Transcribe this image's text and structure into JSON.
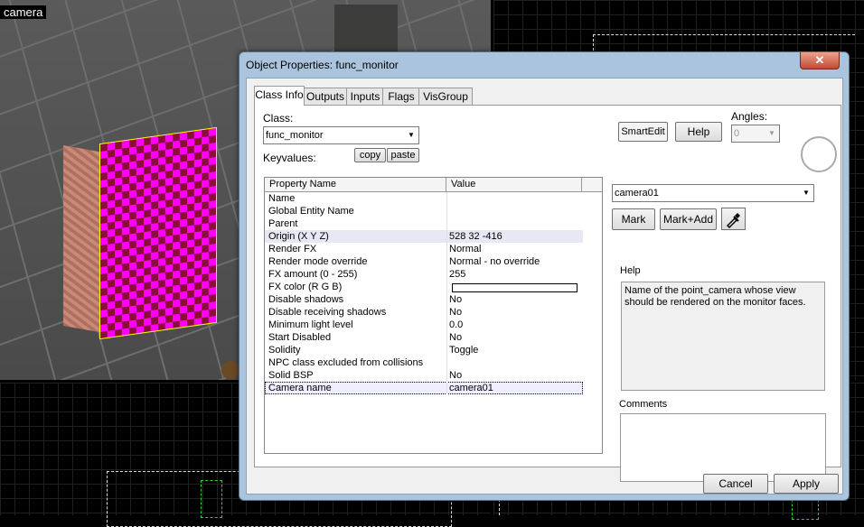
{
  "viewport": {
    "label": "camera"
  },
  "dialog": {
    "title": "Object Properties: func_monitor",
    "close_glyph": "✕",
    "tabs": [
      "Class Info",
      "Outputs",
      "Inputs",
      "Flags",
      "VisGroup"
    ],
    "class_label": "Class:",
    "class_value": "func_monitor",
    "keyvalues_label": "Keyvalues:",
    "copy_label": "copy",
    "paste_label": "paste",
    "smartedit_label": "SmartEdit",
    "help_label": "Help",
    "angles_label": "Angles:",
    "angles_value": "0",
    "columns": [
      "Property Name",
      "Value"
    ],
    "rows": [
      {
        "name": "Name",
        "value": ""
      },
      {
        "name": "Global Entity Name",
        "value": ""
      },
      {
        "name": "Parent",
        "value": ""
      },
      {
        "name": "Origin (X Y Z)",
        "value": "528 32 -416"
      },
      {
        "name": "Render FX",
        "value": "Normal"
      },
      {
        "name": "Render mode override",
        "value": "Normal - no override"
      },
      {
        "name": "FX amount (0 - 255)",
        "value": "255"
      },
      {
        "name": "FX color (R G B)",
        "value": ""
      },
      {
        "name": "Disable shadows",
        "value": "No"
      },
      {
        "name": "Disable receiving shadows",
        "value": "No"
      },
      {
        "name": "Minimum light level",
        "value": "0.0"
      },
      {
        "name": "Start Disabled",
        "value": "No"
      },
      {
        "name": "Solidity",
        "value": "Toggle"
      },
      {
        "name": "NPC class excluded from collisions",
        "value": ""
      },
      {
        "name": "Solid BSP",
        "value": "No"
      },
      {
        "name": "Camera name",
        "value": "camera01"
      }
    ],
    "value_select": "camera01",
    "mark_label": "Mark",
    "markadd_label": "Mark+Add",
    "help_heading": "Help",
    "help_text": "Name of the point_camera whose view should be rendered on the monitor faces.",
    "comments_label": "Comments",
    "cancel_label": "Cancel",
    "apply_label": "Apply",
    "swatch_color": "#ffffff"
  }
}
